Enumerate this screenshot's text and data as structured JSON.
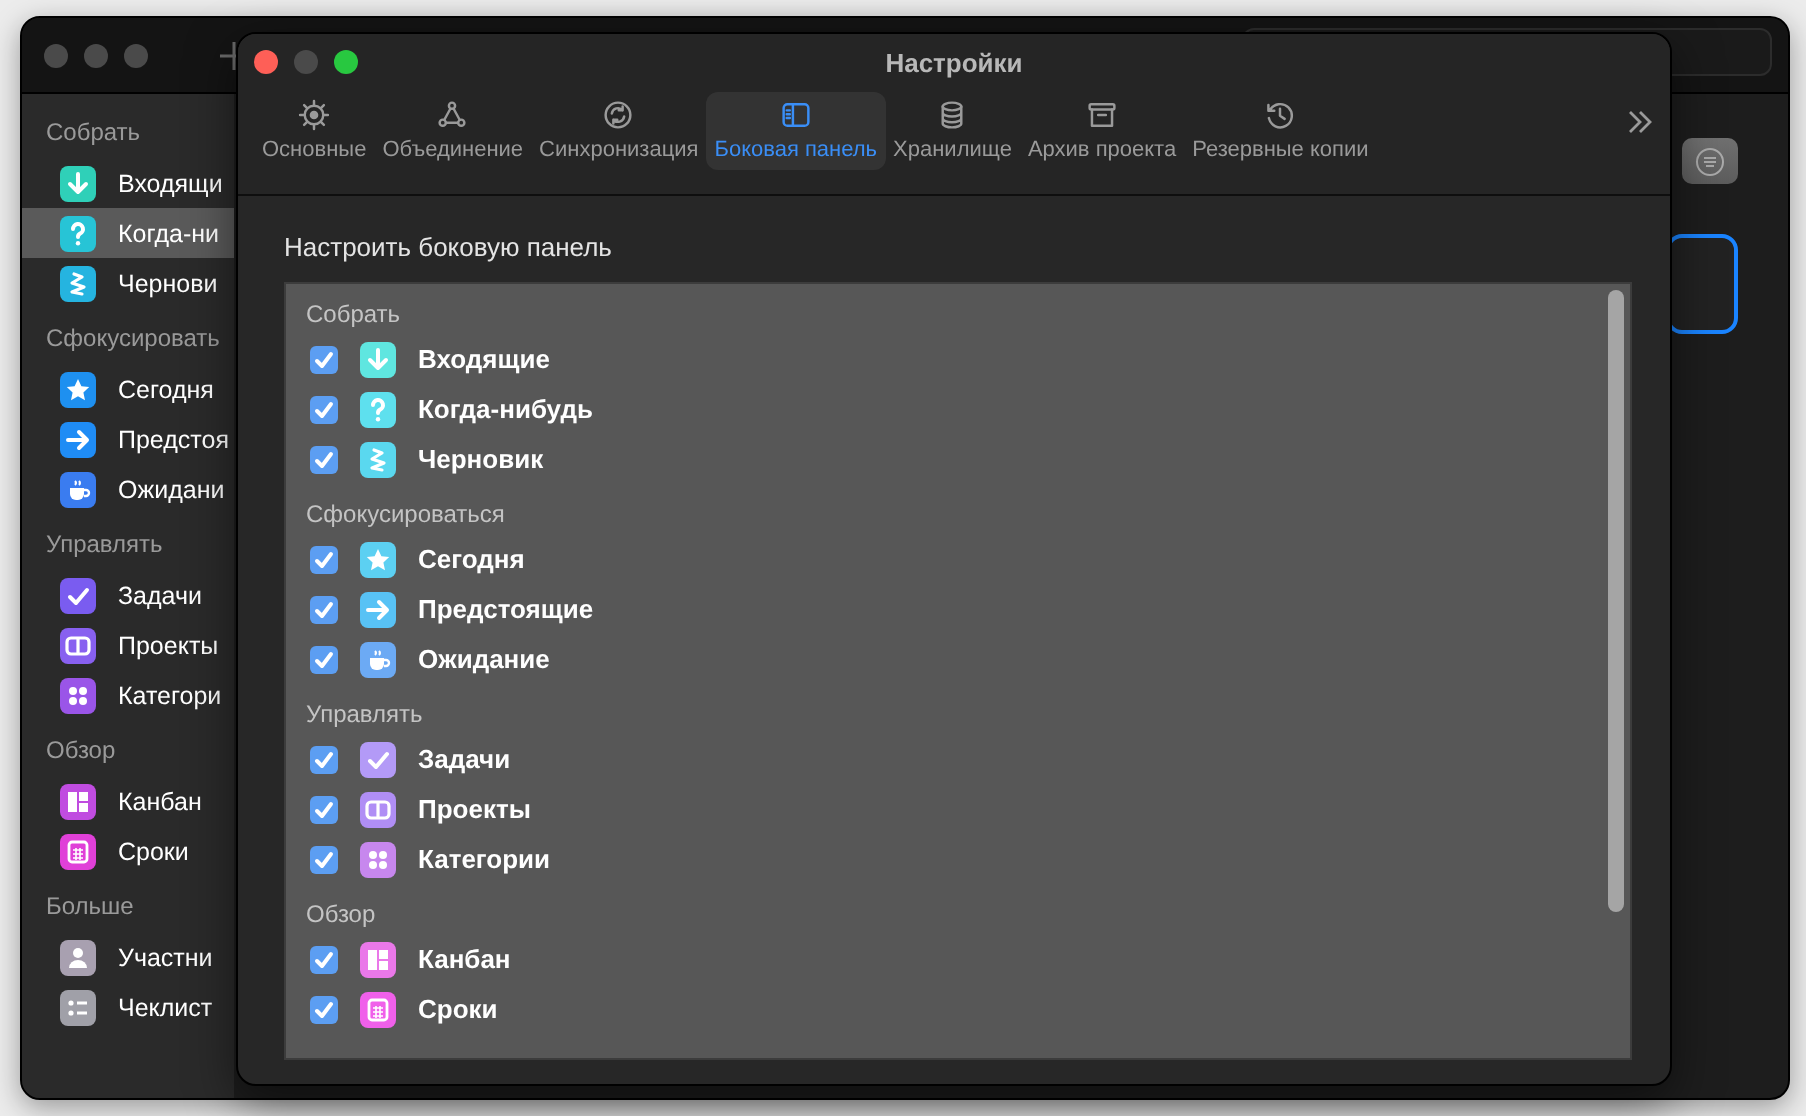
{
  "back_window": {
    "sidebar": {
      "sections": [
        {
          "title": "Собрать",
          "items": [
            {
              "label": "Входящи",
              "kind": "inbox",
              "color": "#2fd0b8",
              "selected": false
            },
            {
              "label": "Когда-ни",
              "kind": "someday",
              "color": "#27c4d6",
              "selected": true
            },
            {
              "label": "Чернови",
              "kind": "drafts",
              "color": "#25b4e0",
              "selected": false
            }
          ]
        },
        {
          "title": "Сфокусировать",
          "items": [
            {
              "label": "Сегодня",
              "kind": "today",
              "color": "#1e90f0",
              "selected": false
            },
            {
              "label": "Предстоя",
              "kind": "upcoming",
              "color": "#1f8cf5",
              "selected": false
            },
            {
              "label": "Ожидани",
              "kind": "waiting",
              "color": "#3a7cf0",
              "selected": false
            }
          ]
        },
        {
          "title": "Управлять",
          "items": [
            {
              "label": "Задачи",
              "kind": "tasks",
              "color": "#7a5cf0",
              "selected": false
            },
            {
              "label": "Проекты",
              "kind": "projects",
              "color": "#8860f0",
              "selected": false
            },
            {
              "label": "Категори",
              "kind": "categories",
              "color": "#9a55e8",
              "selected": false
            }
          ]
        },
        {
          "title": "Обзор",
          "items": [
            {
              "label": "Канбан",
              "kind": "kanban",
              "color": "#c04ce0",
              "selected": false
            },
            {
              "label": "Сроки",
              "kind": "deadlines",
              "color": "#e040d8",
              "selected": false
            }
          ]
        },
        {
          "title": "Больше",
          "items": [
            {
              "label": "Участни",
              "kind": "person",
              "color": "#a8a0b0",
              "selected": false
            },
            {
              "label": "Чеклист",
              "kind": "list",
              "color": "#a0a0a8",
              "selected": false
            }
          ]
        }
      ]
    }
  },
  "preferences": {
    "title": "Настройки",
    "tabs": [
      {
        "label": "Основные",
        "kind": "gear",
        "selected": false
      },
      {
        "label": "Объединение",
        "kind": "network",
        "selected": false
      },
      {
        "label": "Синхронизация",
        "kind": "sync",
        "selected": false
      },
      {
        "label": "Боковая панель",
        "kind": "sidebar",
        "selected": true
      },
      {
        "label": "Хранилище",
        "kind": "storage",
        "selected": false
      },
      {
        "label": "Архив проекта",
        "kind": "archive",
        "selected": false
      },
      {
        "label": "Резервные копии",
        "kind": "history",
        "selected": false
      }
    ],
    "heading": "Настроить боковую панель",
    "groups": [
      {
        "title": "Собрать",
        "items": [
          {
            "label": "Входящие",
            "kind": "inbox",
            "color": "#5fe6e0",
            "checked": true
          },
          {
            "label": "Когда-нибудь",
            "kind": "someday",
            "color": "#5ee0ee",
            "checked": true
          },
          {
            "label": "Черновик",
            "kind": "drafts",
            "color": "#5ad8ef",
            "checked": true
          }
        ]
      },
      {
        "title": "Сфокусироваться",
        "items": [
          {
            "label": "Сегодня",
            "kind": "today",
            "color": "#5cd0f2",
            "checked": true
          },
          {
            "label": "Предстоящие",
            "kind": "upcoming",
            "color": "#58c2f5",
            "checked": true
          },
          {
            "label": "Ожидание",
            "kind": "waiting",
            "color": "#6caaf4",
            "checked": true
          }
        ]
      },
      {
        "title": "Управлять",
        "items": [
          {
            "label": "Задачи",
            "kind": "tasks",
            "color": "#b39af7",
            "checked": true
          },
          {
            "label": "Проекты",
            "kind": "projects",
            "color": "#b08ef5",
            "checked": true
          },
          {
            "label": "Категории",
            "kind": "categories",
            "color": "#c787ee",
            "checked": true
          }
        ]
      },
      {
        "title": "Обзор",
        "items": [
          {
            "label": "Канбан",
            "kind": "kanban",
            "color": "#ea78e9",
            "checked": true
          },
          {
            "label": "Сроки",
            "kind": "deadlines",
            "color": "#f060ea",
            "checked": true
          }
        ]
      }
    ]
  }
}
